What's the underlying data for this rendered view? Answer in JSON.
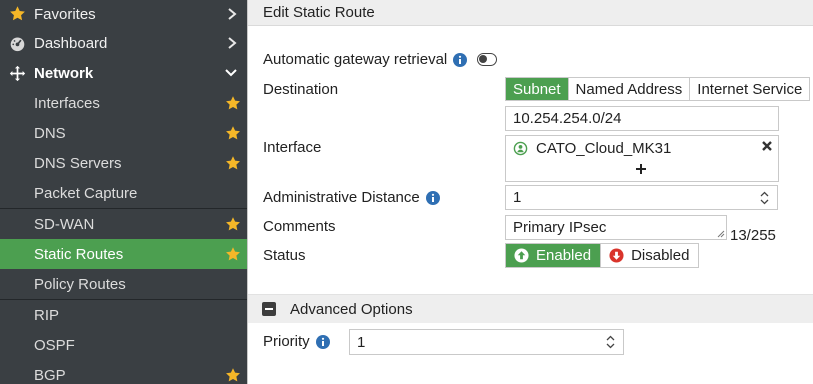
{
  "sidebar": {
    "favorites": "Favorites",
    "dashboard": "Dashboard",
    "network": "Network",
    "items": [
      {
        "label": "Interfaces",
        "starred": true
      },
      {
        "label": "DNS",
        "starred": true
      },
      {
        "label": "DNS Servers",
        "starred": true
      },
      {
        "label": "Packet Capture",
        "starred": false
      },
      {
        "label": "SD-WAN",
        "starred": true
      },
      {
        "label": "Static Routes",
        "starred": true,
        "active": true
      },
      {
        "label": "Policy Routes",
        "starred": false
      },
      {
        "label": "RIP",
        "starred": false
      },
      {
        "label": "OSPF",
        "starred": false
      },
      {
        "label": "BGP",
        "starred": true
      }
    ]
  },
  "header": {
    "title": "Edit Static Route"
  },
  "form": {
    "auto_gateway_label": "Automatic gateway retrieval",
    "auto_gateway_enabled": false,
    "destination_label": "Destination",
    "destination_options": [
      "Subnet",
      "Named Address",
      "Internet Service"
    ],
    "destination_selected": "Subnet",
    "subnet_value": "10.254.254.0/24",
    "interface_label": "Interface",
    "interface_value": "CATO_Cloud_MK31",
    "admin_distance_label": "Administrative Distance",
    "admin_distance_value": "1",
    "comments_label": "Comments",
    "comments_value": "Primary IPsec",
    "comments_count": "13/255",
    "status_label": "Status",
    "status_enabled": "Enabled",
    "status_disabled": "Disabled",
    "status_selected": "Enabled"
  },
  "advanced": {
    "title": "Advanced Options",
    "priority_label": "Priority",
    "priority_value": "1"
  },
  "colors": {
    "accent_green": "#4c9f50",
    "sidebar_bg": "#3a3f43",
    "star": "#f5b728",
    "info": "#2f6fb3"
  }
}
